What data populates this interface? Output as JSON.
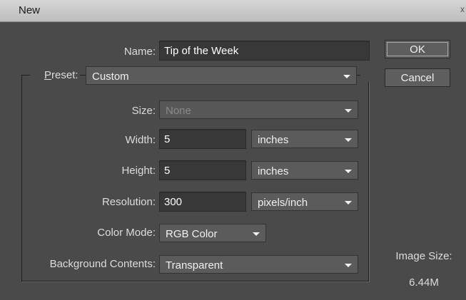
{
  "window": {
    "title": "New",
    "close_glyph": "x"
  },
  "name": {
    "label": "Name:",
    "value": "Tip of the Week"
  },
  "preset": {
    "label_underlined": "P",
    "label_rest": "reset:",
    "value": "Custom"
  },
  "size": {
    "label": "Size:",
    "value": "None"
  },
  "width": {
    "label": "Width:",
    "value": "5",
    "unit": "inches"
  },
  "height": {
    "label": "Height:",
    "value": "5",
    "unit": "inches"
  },
  "resolution": {
    "label": "Resolution:",
    "value": "300",
    "unit": "pixels/inch"
  },
  "color_mode": {
    "label": "Color Mode:",
    "value": "RGB Color"
  },
  "background": {
    "label": "Background Contents:",
    "value": "Transparent"
  },
  "buttons": {
    "ok": "OK",
    "cancel": "Cancel"
  },
  "image_size": {
    "label": "Image Size:",
    "value": "6.44M"
  },
  "icons": {
    "dropdown": "chevron-down-icon"
  }
}
